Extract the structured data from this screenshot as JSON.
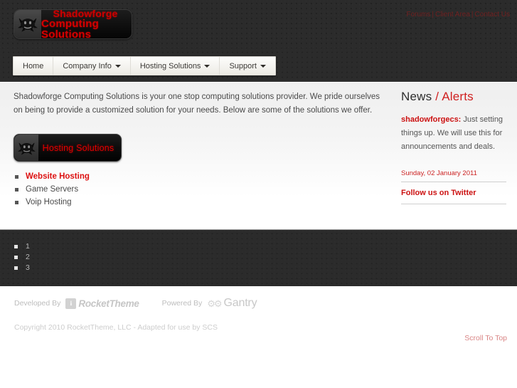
{
  "header": {
    "logo": {
      "line1": "Shadowforge",
      "line2": "Computing Solutions",
      "emblem_icon": "crab-emblem-icon"
    },
    "top_links": [
      {
        "label": "Forums"
      },
      {
        "label": "Client Area"
      },
      {
        "label": "Contact Us"
      }
    ],
    "separator": "|"
  },
  "nav": {
    "items": [
      {
        "label": "Home",
        "has_caret": false
      },
      {
        "label": "Company Info",
        "has_caret": true
      },
      {
        "label": "Hosting Solutions",
        "has_caret": true
      },
      {
        "label": "Support",
        "has_caret": true
      }
    ]
  },
  "main": {
    "intro": "Shadowforge Computing Solutions is your one stop computing solutions provider. We pride ourselves on being to provide a customized solution for your needs. Below are some of the solutions we offer.",
    "section_banner": {
      "title": "Hosting Solutions",
      "emblem_icon": "crab-emblem-icon"
    },
    "solutions": [
      {
        "label": "Website Hosting",
        "active": true
      },
      {
        "label": "Game Servers",
        "active": false
      },
      {
        "label": "Voip Hosting",
        "active": false
      }
    ]
  },
  "sidebar": {
    "title_news": "News",
    "title_slash": "/",
    "title_alerts": "Alerts",
    "tweet_handle": "shadowforgecs:",
    "tweet_body": " Just setting things up. We will use this for announcements and deals.",
    "tweet_date": "Sunday, 02 January 2011",
    "follow_link": "Follow us on Twitter"
  },
  "bottom_panel": {
    "items": [
      {
        "label": "1"
      },
      {
        "label": "2"
      },
      {
        "label": "3"
      }
    ]
  },
  "footer": {
    "developed_by": "Developed By",
    "rocket_theme_mark": "i",
    "rocket_theme": "RocketTheme",
    "powered_by": "Powered By",
    "gears_icon": "gears-icon",
    "gantry": "Gantry",
    "copyright": "Copyright 2010 RocketTheme, LLC - Adapted for use by SCS",
    "scroll_to_top": "Scroll To Top"
  },
  "colors": {
    "brand_red": "#cc0000",
    "dark_panel": "#2b2b2b",
    "accent_link": "#dd1111",
    "muted_text": "#bdbdbd"
  }
}
